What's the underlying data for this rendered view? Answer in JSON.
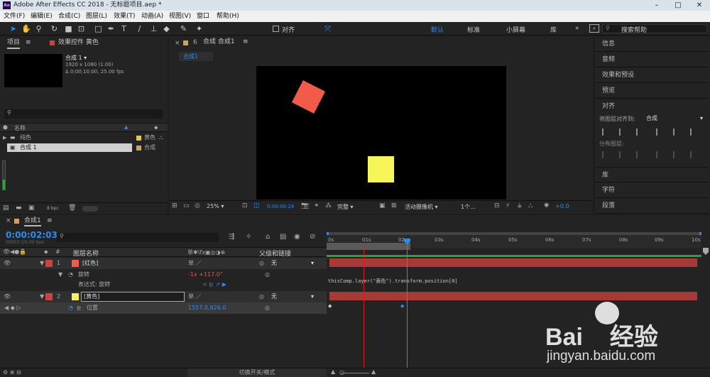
{
  "app": {
    "title": "Adobe After Effects CC 2018 - 无标题项目.aep *",
    "logo": "Ae"
  },
  "menu": [
    "文件(F)",
    "编辑(E)",
    "合成(C)",
    "图层(L)",
    "效果(T)",
    "动画(A)",
    "视图(V)",
    "窗口",
    "帮助(H)"
  ],
  "toolbar": {
    "align_label": "对齐",
    "workspaces": [
      "默认",
      "标准",
      "小屏幕",
      "库"
    ],
    "search_placeholder": "搜索帮助",
    "active_workspace": "默认"
  },
  "project": {
    "tab": "项目",
    "effects_tab": "效果控件 黄色",
    "comp_name": "合成 1",
    "comp_info1": "1920 x 1080 (1.00)",
    "comp_info2": "Δ 0;00;10;00, 25.00 fps",
    "col_name": "名称",
    "items": [
      {
        "name": "纯色",
        "type": "黄色"
      },
      {
        "name": "合成 1",
        "type": "合成"
      }
    ],
    "bpc": "8 bpc"
  },
  "comp": {
    "tab": "合成 合成1",
    "subtab": "合成1",
    "zoom": "25%",
    "timecode": "0:00:00:24",
    "quality": "完整",
    "camera": "活动摄像机",
    "views": "1个...",
    "exposure": "+0.0"
  },
  "right": {
    "items": [
      "信息",
      "音频",
      "效果和预设",
      "预览",
      "对齐",
      "库",
      "字符",
      "段落"
    ],
    "align_to_label": "将图层对齐到:",
    "align_to_value": "合成",
    "distribute_label": "分布图层:"
  },
  "timeline": {
    "tab": "合成1",
    "timecode": "0:00:02:03",
    "timecode_sub": "00053 (25.00 fps)",
    "col_layer": "图层名称",
    "col_parent": "父级和链接",
    "layers": [
      {
        "num": "1",
        "name": "[红色]",
        "color": "#c8463e",
        "parent": "无",
        "prop": "旋转",
        "value": "-1x +117.0°",
        "expr_label": "表达式: 旋转"
      },
      {
        "num": "2",
        "name": "[黄色]",
        "color": "#f4f15c",
        "parent": "无",
        "prop": "位置",
        "value": "1557.0,826.0"
      }
    ],
    "expression": "thisComp.layer(\"黄色\").transform.position[0]",
    "ruler": [
      "0s",
      "01s",
      "02s",
      "03s",
      "04s",
      "05s",
      "06s",
      "07s",
      "08s",
      "09s",
      "10s"
    ],
    "bottom_label": "切换开关/模式"
  },
  "watermark": {
    "brand": "Bai",
    "brand2": "经验",
    "url": "jingyan.baidu.com"
  },
  "colors": {
    "accent": "#2d8ceb",
    "red_layer": "#c8463e",
    "yellow_layer": "#f4f15c"
  }
}
